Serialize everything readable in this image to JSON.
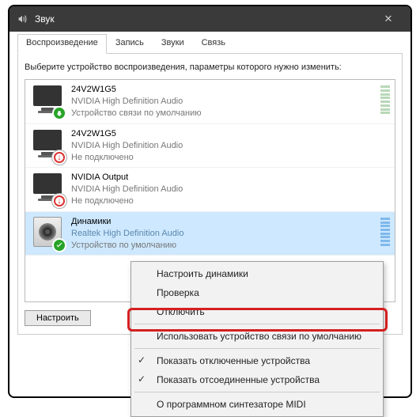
{
  "window": {
    "title": "Звук",
    "close": "✕"
  },
  "tabs": {
    "items": [
      {
        "label": "Воспроизведение",
        "active": true
      },
      {
        "label": "Запись"
      },
      {
        "label": "Звуки"
      },
      {
        "label": "Связь"
      }
    ]
  },
  "instruction": "Выберите устройство воспроизведения, параметры которого нужно изменить:",
  "devices": [
    {
      "name": "24V2W1G5",
      "desc": "NVIDIA High Definition Audio",
      "status": "Устройство связи по умолчанию",
      "icon": "monitor",
      "badge": "ok"
    },
    {
      "name": "24V2W1G5",
      "desc": "NVIDIA High Definition Audio",
      "status": "Не подключено",
      "icon": "monitor",
      "badge": "down"
    },
    {
      "name": "NVIDIA Output",
      "desc": "NVIDIA High Definition Audio",
      "status": "Не подключено",
      "icon": "monitor",
      "badge": "down"
    },
    {
      "name": "Динамики",
      "desc": "Realtek High Definition Audio",
      "status": "Устройство по умолчанию",
      "icon": "speaker",
      "badge": "ok",
      "selected": true
    }
  ],
  "buttons": {
    "configure": "Настроить"
  },
  "context_menu": {
    "items": [
      {
        "label": "Настроить динамики"
      },
      {
        "label": "Проверка"
      },
      {
        "label": "Отключить"
      },
      {
        "sep": true
      },
      {
        "label": "Использовать устройство связи по умолчанию",
        "highlight": true
      },
      {
        "sep": true
      },
      {
        "label": "Показать отключенные устройства",
        "checked": true
      },
      {
        "label": "Показать отсоединенные устройства",
        "checked": true
      },
      {
        "sep": true
      },
      {
        "label": "О программном синтезаторе MIDI"
      }
    ]
  }
}
